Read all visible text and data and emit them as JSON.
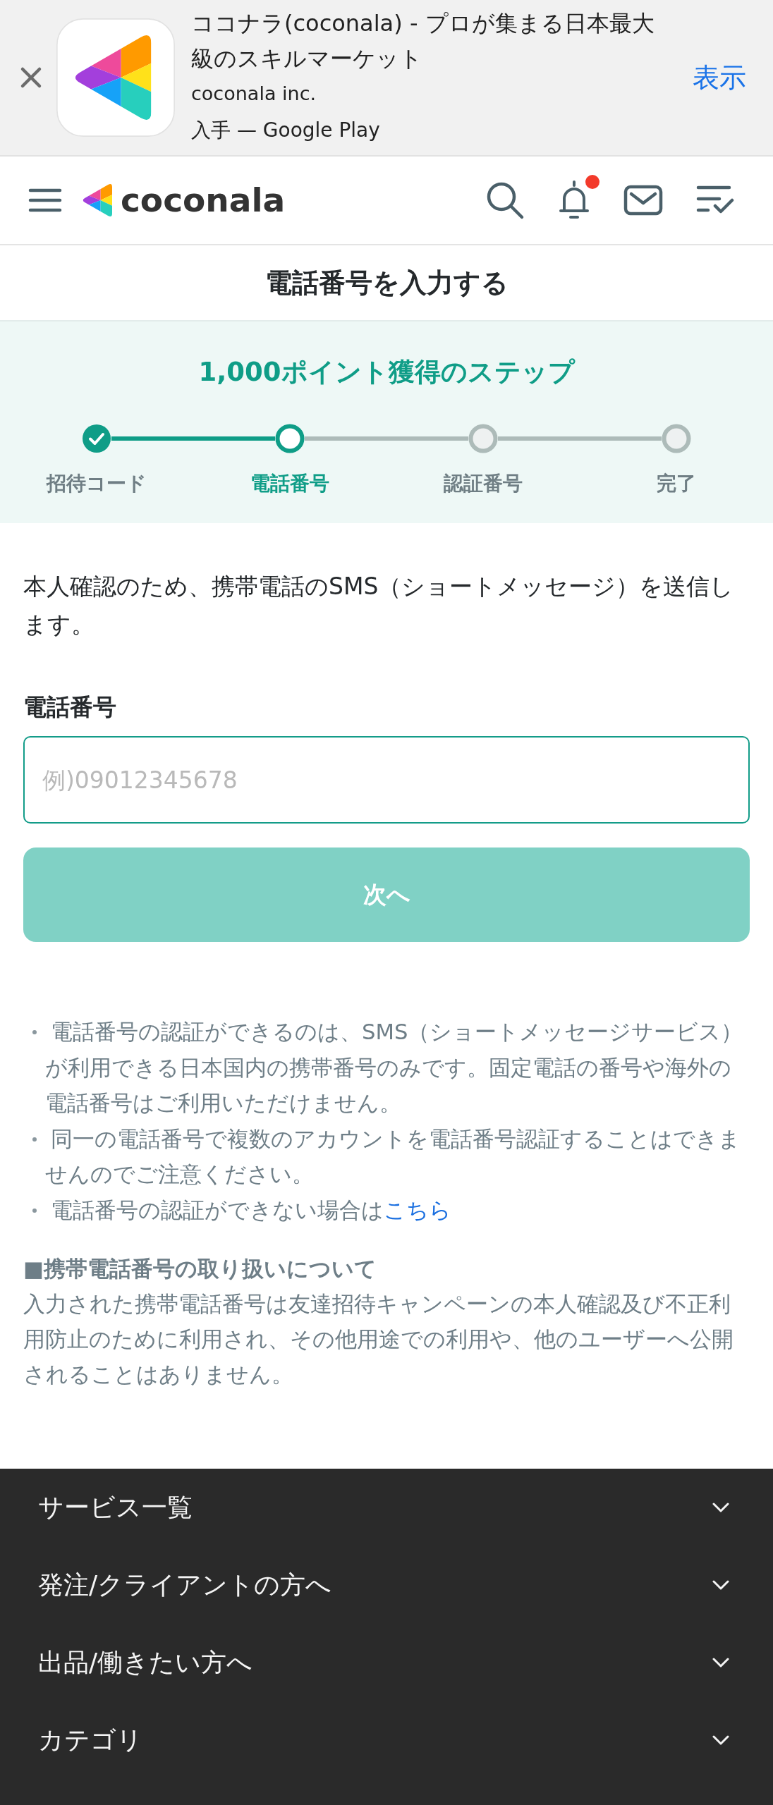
{
  "app_banner": {
    "title": "ココナラ(coconala) - プロが集まる日本最大級のスキルマーケット",
    "publisher": "coconala inc.",
    "store": "入手 — Google Play",
    "action": "表示"
  },
  "header": {
    "logo": "coconala",
    "unread_notifications": true
  },
  "page_title": "電話番号を入力する",
  "steps": {
    "title": "1,000ポイント獲得のステップ",
    "items": [
      {
        "label": "招待コード",
        "done": true,
        "selected": false
      },
      {
        "label": "電話番号",
        "done": false,
        "selected": true
      },
      {
        "label": "認証番号",
        "done": false,
        "selected": false
      },
      {
        "label": "完了",
        "done": false,
        "selected": false
      }
    ]
  },
  "form": {
    "intro": "本人確認のため、携帯電話のSMS（ショートメッセージ）を送信します。",
    "label": "電話番号",
    "placeholder": "例)09012345678",
    "focused": true,
    "submit": {
      "label": "次へ",
      "disabled": true
    }
  },
  "notes": [
    {
      "text": "電話番号の認証ができるのは、SMS（ショートメッセージサービス）が利用できる日本国内の携帯番号のみです。固定電話の番号や海外の電話番号はご利用いただけません。"
    },
    {
      "text": "同一の電話番号で複数のアカウントを電話番号認証することはできませんのでご注意ください。"
    },
    {
      "text": "電話番号の認証ができない場合は",
      "link": "こちら"
    }
  ],
  "policy": {
    "heading": "■携帯電話番号の取り扱いについて",
    "text": "入力された携帯電話番号は友達招待キャンペーンの本人確認及び不正利用防止のために利用され、その他用途での利用や、他のユーザーへ公開されることはありません。"
  },
  "footer": {
    "items": [
      {
        "label": "サービス一覧",
        "expanded": false
      },
      {
        "label": "発注/クライアントの方へ",
        "expanded": false
      },
      {
        "label": "出品/働きたい方へ",
        "expanded": false
      },
      {
        "label": "カテゴリ",
        "expanded": false
      }
    ]
  }
}
